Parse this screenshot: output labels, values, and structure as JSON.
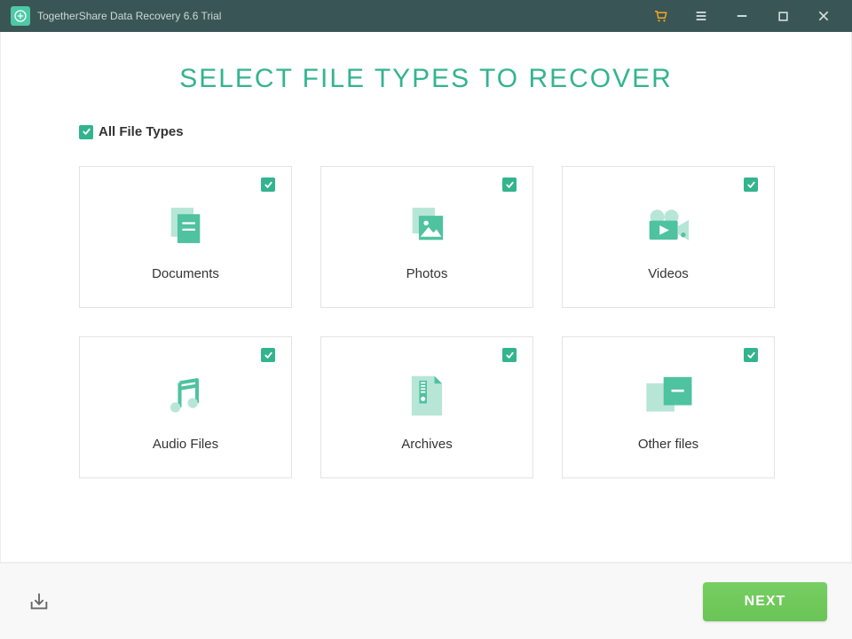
{
  "app": {
    "title": "TogetherShare Data Recovery 6.6 Trial"
  },
  "heading": "SELECT FILE TYPES TO RECOVER",
  "all_types_label": "All File Types",
  "cards": {
    "documents": {
      "label": "Documents"
    },
    "photos": {
      "label": "Photos"
    },
    "videos": {
      "label": "Videos"
    },
    "audio": {
      "label": "Audio Files"
    },
    "archives": {
      "label": "Archives"
    },
    "other": {
      "label": "Other files"
    }
  },
  "footer": {
    "next_label": "NEXT"
  },
  "colors": {
    "accent": "#33b48f",
    "accent_light": "#8fd6c0",
    "next_button": "#74cc5f"
  }
}
